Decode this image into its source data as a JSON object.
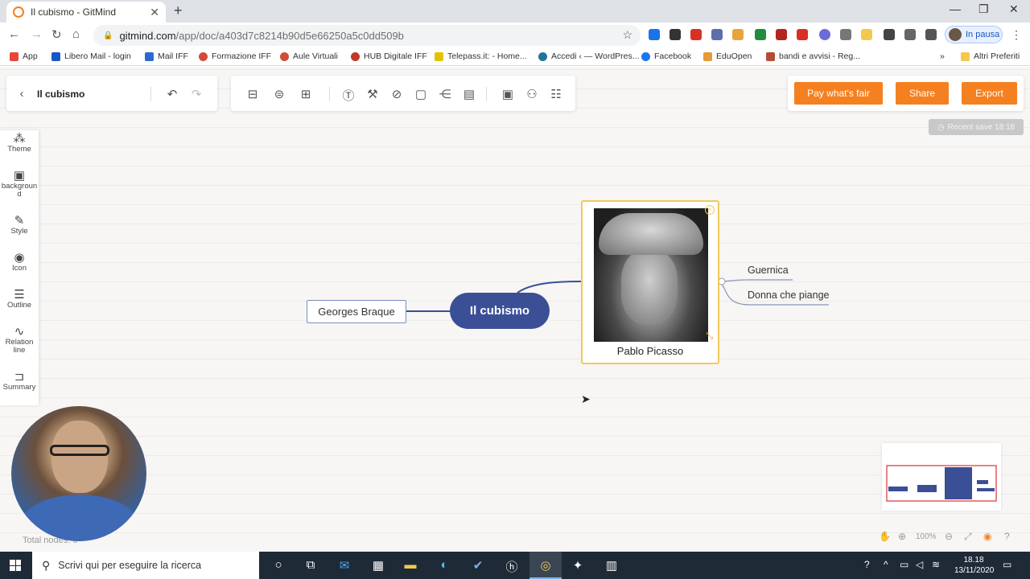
{
  "browser": {
    "tab_title": "Il cubismo - GitMind",
    "tab_close": "✕",
    "new_tab": "+",
    "window_controls": [
      "—",
      "❐",
      "✕"
    ],
    "url_host": "gitmind.com",
    "url_path": "/app/doc/a403d7c8214b90d5e66250a5c0dd509b",
    "profile_label": "In pausa",
    "bookmarks": [
      {
        "label": "App",
        "color": "#e8453c"
      },
      {
        "label": "Libero Mail - login",
        "color": "#1a56c4"
      },
      {
        "label": "Mail IFF",
        "color": "#2c6ad1"
      },
      {
        "label": "Formazione IFF",
        "color": "#d14b3a"
      },
      {
        "label": "Aule Virtuali",
        "color": "#d14b3a"
      },
      {
        "label": "HUB Digitale IFF",
        "color": "#c0392b"
      },
      {
        "label": "Telepass.it: - Home...",
        "color": "#e3c200"
      },
      {
        "label": "Accedi ‹ — WordPres...",
        "color": "#21759b"
      },
      {
        "label": "Facebook",
        "color": "#1877f2"
      },
      {
        "label": "EduOpen",
        "color": "#e69a3b"
      },
      {
        "label": "bandi e avvisi - Reg...",
        "color": "#b44c35"
      },
      {
        "label": "Altri Preferiti",
        "color": "#f2c94c"
      }
    ],
    "more_bookmarks": "»"
  },
  "app": {
    "doc_title": "Il cubismo",
    "buttons": {
      "pay": "Pay what's fair",
      "share": "Share",
      "export": "Export"
    },
    "save_status": "Recent save 18:18",
    "sidebar": [
      {
        "label": "Theme",
        "icon": "⁂"
      },
      {
        "label": "background",
        "icon": "▣"
      },
      {
        "label": "Style",
        "icon": "✎"
      },
      {
        "label": "Icon",
        "icon": "◉"
      },
      {
        "label": "Outline",
        "icon": "☰"
      },
      {
        "label": "Relation line",
        "icon": "∿"
      },
      {
        "label": "Summary",
        "icon": "⊐"
      }
    ],
    "mindmap": {
      "root": "Il cubismo",
      "left_node": "Georges Braque",
      "image_node_label": "Pablo Picasso",
      "branches": [
        "Guernica",
        "Donna che piange"
      ]
    },
    "zoom": "100%",
    "total_nodes": "Total nodes: 6"
  },
  "taskbar": {
    "search_placeholder": "Scrivi qui per eseguire la ricerca",
    "time": "18.18",
    "date": "13/11/2020"
  }
}
